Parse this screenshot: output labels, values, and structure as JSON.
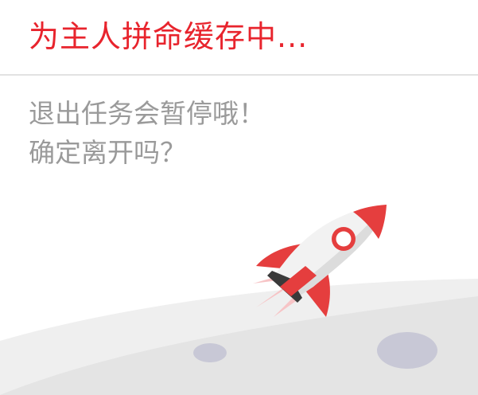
{
  "dialog": {
    "title": "为主人拼命缓存中...",
    "message_line1": "退出任务会暂停哦！",
    "message_line2": "确定离开吗？"
  },
  "illustration": {
    "icons": [
      "rocket-icon",
      "moon-surface"
    ],
    "colors": {
      "accent": "#e8242d",
      "rocket_body": "#f2f2f2",
      "rocket_fin": "#e53e3e",
      "ground": "#e9e9e9",
      "crater": "#c8c8d6"
    }
  }
}
